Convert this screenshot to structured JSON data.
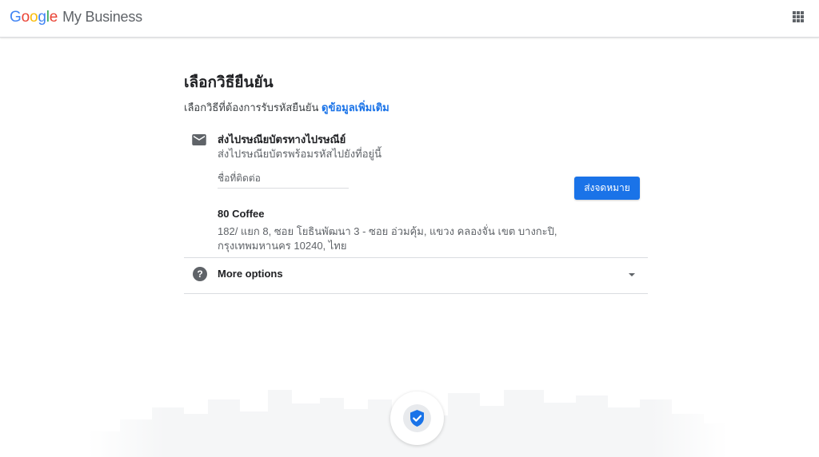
{
  "header": {
    "logo_letters": [
      "G",
      "o",
      "o",
      "g",
      "l",
      "e"
    ],
    "logo_colors": [
      "#4285F4",
      "#EA4335",
      "#FBBC05",
      "#4285F4",
      "#34A853",
      "#EA4335"
    ],
    "product_name": "My Business",
    "apps_icon": "apps-grid-icon"
  },
  "main": {
    "title": "เลือกวิธียืนยัน",
    "subtitle_text": "เลือกวิธีที่ต้องการรับรหัสยืนยัน",
    "learn_more_link": "ดูข้อมูลเพิ่มเติม"
  },
  "mail_option": {
    "icon": "mail-icon",
    "title": "ส่งไปรษณียบัตรทางไปรษณีย์",
    "description": "ส่งไปรษณียบัตรพร้อมรหัสไปยังที่อยู่นี้",
    "contact_field_placeholder": "ชื่อที่ติดต่อ",
    "send_button_label": "ส่งจดหมาย",
    "business_name": "80 Coffee",
    "address_line1": "182/ แยก 8, ซอย โยธินพัฒนา 3 - ซอย อ่วมคุ้ม, แขวง คลองจั่น เขต บางกะปิ,",
    "address_line2": "กรุงเทพมหานคร 10240, ไทย"
  },
  "more_options": {
    "icon": "help-circle-icon",
    "label": "More options",
    "caret_icon": "caret-down-icon"
  },
  "footer": {
    "badge_icon": "shield-check-icon"
  },
  "colors": {
    "primary": "#1a73e8",
    "text": "#202124",
    "secondary_text": "#5f6368",
    "divider": "#dadce0",
    "skyline": "#f6f7f8"
  }
}
